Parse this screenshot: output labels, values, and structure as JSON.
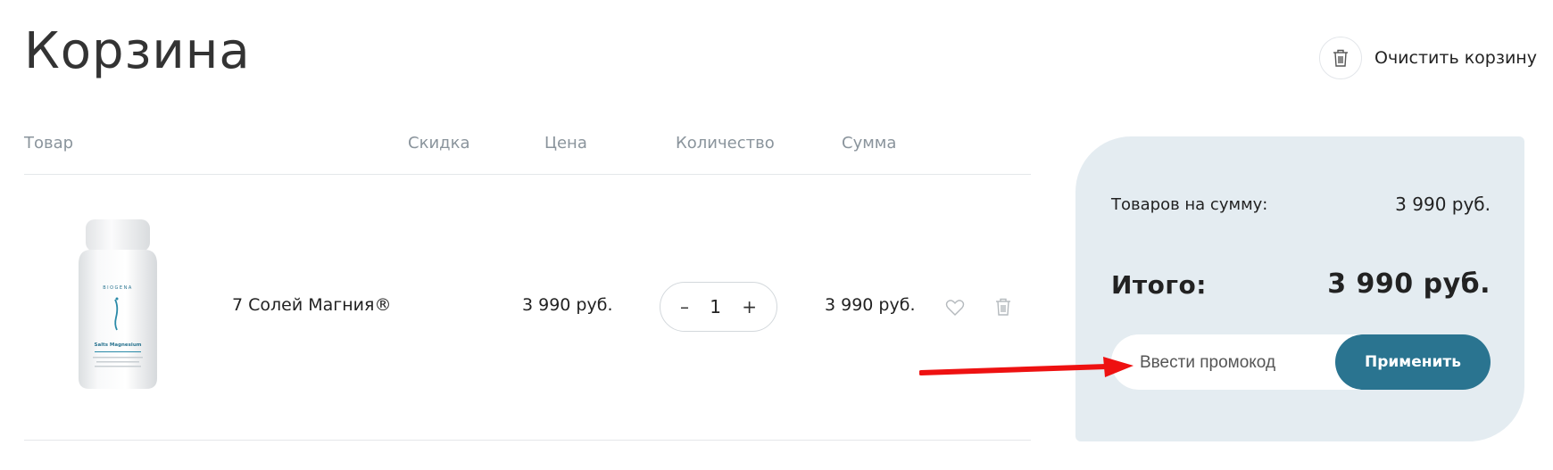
{
  "page": {
    "title": "Корзина"
  },
  "clear_cart": {
    "label": "Очистить корзину",
    "icon": "trash-icon"
  },
  "table": {
    "headers": {
      "product": "Товар",
      "discount": "Скидка",
      "price": "Цена",
      "quantity": "Количество",
      "sum": "Сумма"
    },
    "rows": [
      {
        "name": "7 Солей Магния®",
        "price": "3 990 руб.",
        "quantity": "1",
        "sum": "3 990 руб.",
        "image_label": {
          "brand": "BIOGENA",
          "product": "Salts Magnesium"
        }
      }
    ]
  },
  "quantity_controls": {
    "decrement": "–",
    "increment": "+"
  },
  "summary": {
    "items_label": "Товаров на сумму:",
    "items_value": "3 990 руб.",
    "total_label": "Итого:",
    "total_value": "3 990 руб.",
    "promo_placeholder": "Ввести промокод",
    "apply_label": "Применить"
  },
  "colors": {
    "accent": "#2a7490",
    "summary_bg": "#e4ecf1",
    "header_text": "#8a949c",
    "annotation_arrow": "#ee1111"
  }
}
